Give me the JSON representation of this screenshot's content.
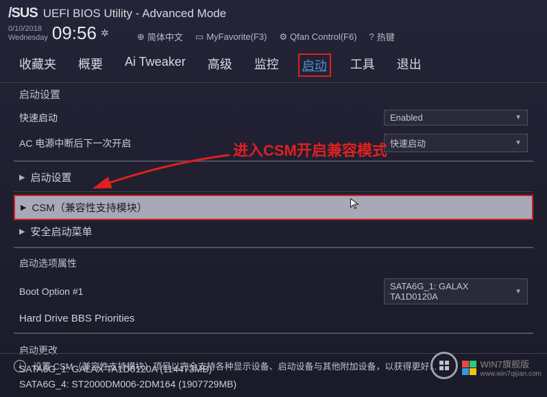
{
  "header": {
    "logo": "/SUS",
    "title": "UEFI BIOS Utility - Advanced Mode",
    "date": "0/10/2018",
    "weekday": "Wednesday",
    "time": "09:56"
  },
  "toolbar": {
    "language": "简体中文",
    "favorite": "MyFavorite(F3)",
    "qfan": "Qfan Control(F6)",
    "hotkey": "热键"
  },
  "tabs": {
    "items": [
      {
        "label": "收藏夹"
      },
      {
        "label": "概要"
      },
      {
        "label": "Ai Tweaker"
      },
      {
        "label": "高级"
      },
      {
        "label": "监控"
      },
      {
        "label": "启动"
      },
      {
        "label": "工具"
      },
      {
        "label": "退出"
      }
    ],
    "active_index": 5
  },
  "subtitle": "启动设置",
  "settings": {
    "fastboot": {
      "label": "快速启动",
      "value": "Enabled"
    },
    "acpower": {
      "label": "AC 电源中断后下一次开启",
      "value": "快速启动"
    }
  },
  "sections": {
    "boot_settings": "启动设置",
    "csm": "CSM（兼容性支持模块）",
    "secure_boot": "安全启动菜单"
  },
  "boot_props": {
    "header": "启动选项属性",
    "option1": {
      "label": "Boot Option #1",
      "value": "SATA6G_1: GALAX TA1D0120A"
    },
    "hdd_priorities": "Hard Drive BBS Priorities"
  },
  "boot_changes": {
    "header": "启动更改",
    "drive1": "SATA6G_1: GALAX TA1D0120A  (114473MB)",
    "drive2": "SATA6G_4: ST2000DM006-2DM164  (1907729MB)"
  },
  "annotation": "进入CSM开启兼容模式",
  "footer": {
    "help": "设置 CSM（兼容性支持模块）项目以完全支持各种显示设备、启动设备与其他附加设备，以获得更好..."
  },
  "watermark": {
    "text": "WIN7旗舰版",
    "url": "www.win7qijian.com"
  }
}
